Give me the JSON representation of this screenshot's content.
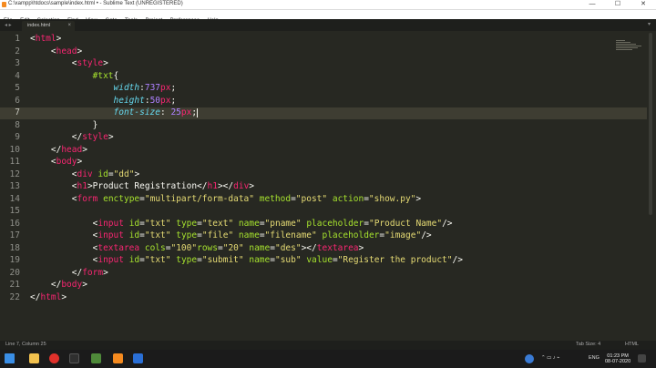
{
  "window": {
    "title": "C:\\xampp\\htdocs\\sample\\index.html • - Sublime Text (UNREGISTERED)",
    "minimize": "—",
    "maximize": "☐",
    "close": "✕"
  },
  "menu": [
    "File",
    "Edit",
    "Selection",
    "Find",
    "View",
    "Goto",
    "Tools",
    "Project",
    "Preferences",
    "Help"
  ],
  "tab": {
    "label": "index.html",
    "close": "×"
  },
  "line_numbers": [
    "1",
    "2",
    "3",
    "4",
    "5",
    "6",
    "7",
    "8",
    "9",
    "10",
    "11",
    "12",
    "13",
    "14",
    "15",
    "16",
    "17",
    "18",
    "19",
    "20",
    "21",
    "22"
  ],
  "status": {
    "left": "Line 7, Column 25",
    "tab_size": "Tab Size: 4",
    "syntax": "HTML"
  },
  "taskbar": {
    "lang": "ENG",
    "time": "01:23 PM",
    "date": "08-07-2020"
  },
  "colors": {
    "editor_bg": "#272822",
    "tag": "#f92672",
    "attr": "#a6e22e",
    "string": "#e6db74",
    "number": "#ae81ff",
    "property": "#66d9ef"
  }
}
